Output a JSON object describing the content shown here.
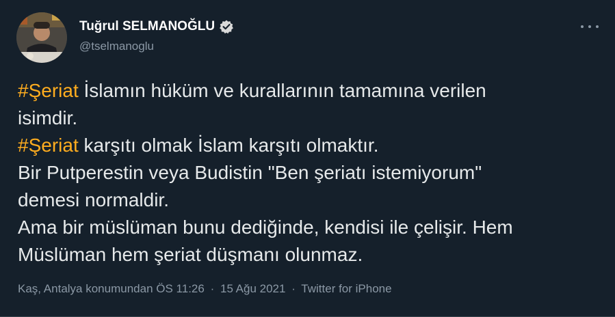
{
  "author": {
    "name": "Tuğrul SELMANOĞLU",
    "handle": "@tselmanoglu",
    "verified": true
  },
  "tweet": {
    "lines": [
      {
        "hashtag": "#Şeriat",
        "text": " İslamın hüküm ve kurallarının tamamına verilen"
      },
      {
        "hashtag": "",
        "text": "isimdir."
      },
      {
        "hashtag": "#Şeriat",
        "text": " karşıtı olmak İslam karşıtı olmaktır."
      },
      {
        "hashtag": "",
        "text": "Bir Putperestin veya Budistin \"Ben şeriatı istemiyorum\""
      },
      {
        "hashtag": "",
        "text": "demesi normaldir."
      },
      {
        "hashtag": "",
        "text": "Ama bir müslüman bunu dediğinde, kendisi ile çelişir. Hem"
      },
      {
        "hashtag": "",
        "text": "Müslüman hem şeriat düşmanı olunmaz."
      }
    ]
  },
  "meta": {
    "location": "Kaş, Antalya konumundan",
    "time": "ÖS 11:26",
    "date": "15 Ağu 2021",
    "source": "Twitter for iPhone",
    "separator": "·"
  },
  "colors": {
    "background": "#15202b",
    "hashtag": "#ffad1f",
    "verified": "#d9d9d9",
    "secondary_text": "#8b98a5"
  },
  "icons": {
    "verified": "verified-badge-icon",
    "more": "more-options-icon"
  }
}
